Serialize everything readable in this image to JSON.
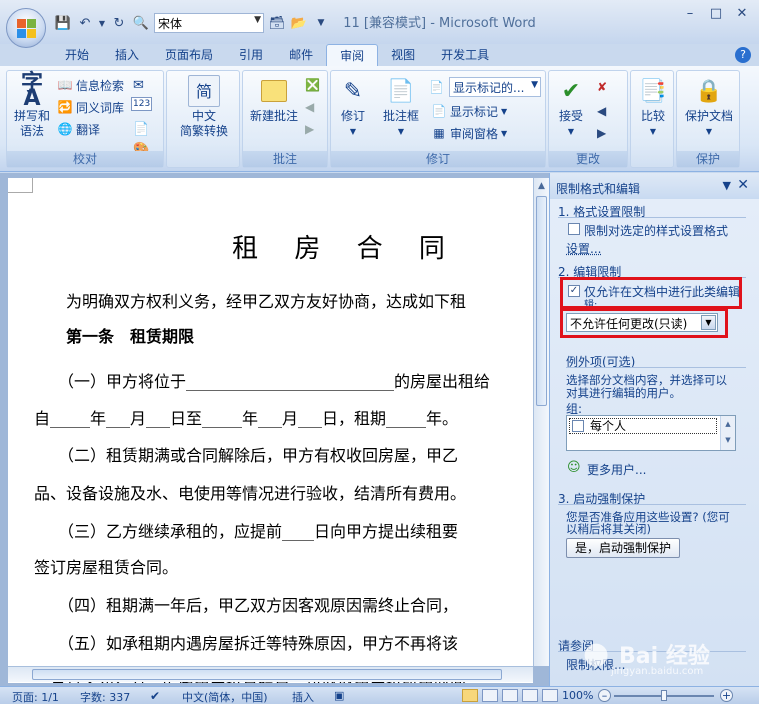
{
  "window": {
    "title": "11 [兼容模式] - Microsoft Word",
    "font_name": "宋体"
  },
  "tabs": [
    "开始",
    "插入",
    "页面布局",
    "引用",
    "邮件",
    "审阅",
    "视图",
    "开发工具"
  ],
  "active_tab": "审阅",
  "ribbon": {
    "proofing": {
      "label": "校对",
      "spelling": "拼写和\n语法",
      "research": "信息检索",
      "thesaurus": "同义词库",
      "translate": "翻译"
    },
    "chinese": {
      "convert": "中文\n简繁转换"
    },
    "comments": {
      "label": "批注",
      "new_comment": "新建批注"
    },
    "tracking": {
      "label": "修订",
      "track_changes": "修订",
      "balloons": "批注框",
      "display_select": "显示标记的...",
      "show_markup": "显示标记",
      "reviewing_pane": "审阅窗格"
    },
    "changes": {
      "label": "更改",
      "accept": "接受"
    },
    "compare": {
      "compare": "比较"
    },
    "protect": {
      "label": "保护",
      "protect_doc": "保护文档"
    }
  },
  "document": {
    "title": "租 房 合 同",
    "lines": [
      "　　为明确双方权利义务，经甲乙双方友好协商，达成如下租",
      "　　第一条　租赁期限",
      "　　（一）甲方将位于__________________________的房屋出租给",
      "自_____年___月___日至_____年___月___日，租期_____年。",
      "　　（二）租赁期满或合同解除后，甲方有权收回房屋，甲乙",
      "品、设备设施及水、电使用等情况进行验收，结清所有费用。",
      "　　（三）乙方继续承租的，应提前____日向甲方提出续租要",
      "签订房屋租赁合同。",
      "　　（四）租期满一年后，甲乙双方因客观原因需终止合同，",
      "　　（五）如承租期内遇房屋拆迁等特殊原因，甲方不再将该",
      "，合旦失知乙方，房屋租金按月结算，可收取租金按所租时间"
    ]
  },
  "pane": {
    "title": "限制格式和编辑",
    "section1": "1. 格式设置限制",
    "format_checkbox": "限制对选定的样式设置格式",
    "settings_link": "设置...",
    "section2": "2. 编辑限制",
    "edit_checkbox": "仅允许在文档中进行此类编辑",
    "edit_checkbox_line2": "辑:",
    "edit_select": "不允许任何更改(只读)",
    "exceptions": "例外项(可选)",
    "exceptions_desc1": "选择部分文档内容，并选择可以",
    "exceptions_desc2": "对其进行编辑的用户。",
    "group_label": "组:",
    "group_item": "每个人",
    "more_users": "更多用户...",
    "section3": "3. 启动强制保护",
    "enforce_desc1": "您是否准备应用这些设置? (您可",
    "enforce_desc2": "以稍后将其关闭)",
    "enforce_button": "是，启动强制保护",
    "see_also": "请参阅",
    "restrict_link": "限制权限..."
  },
  "status": {
    "page": "页面: 1/1",
    "words": "字数: 337",
    "lang": "中文(简体，中国)",
    "mode": "插入",
    "zoom": "100%",
    "zoom_level": 0.5
  },
  "watermark": {
    "text": "Bai 经验",
    "url": "jingyan.baidu.com"
  },
  "colors": {
    "highlight": "#e0121b",
    "accent": "#15428b"
  }
}
